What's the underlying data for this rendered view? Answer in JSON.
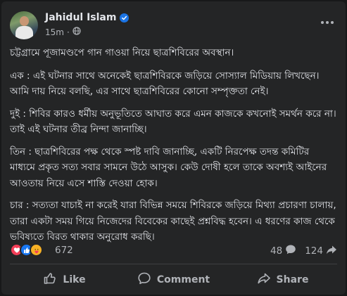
{
  "post": {
    "author": "Jahidul Islam",
    "time": "15m",
    "paragraphs": [
      "চট্টগ্রামে পূজামণ্ডপে গান গাওয়া নিয়ে ছাত্রশিবিরের অবস্থান।",
      "এক : এই ঘটনার সাথে অনেকেই ছাত্রশিবিরকে জড়িয়ে সোস্যাল মিডিয়ায় লিখছেন। আমি দায় নিয়ে বলছি, এর সাথে ছাত্রশিবিরের কোনো সম্পৃক্ততা নেই।",
      "দুই : শিবির কারও ধর্মীয় অনুভূতিতে আঘাত করে এমন কাজকে কখনোই সমর্থন করে না। তাই এই ঘটনার তীব্র নিন্দা জানাচ্ছি।",
      "তিন : ছাত্রশিবিরের পক্ষ থেকে স্পষ্ট দাবি জানাচ্ছি, একটি নিরপেক্ষ তদন্ত কমিটির মাধ্যমে প্রকৃত সত্য সবার সামনে উঠে আসুক। কেউ দোষী হলে তাকে অবশ্যই আইনের আওতায় নিয়ে এসে শাস্তি দেওয়া হোক।",
      "চার : সত্যতা যাচাই না করেই যারা বিভিন্ন সময়ে শিবিরকে জড়িয়ে মিথ্যা প্রচারণা চালায়, তারা একটা সময় গিয়ে নিজেদের বিবেকের কাছেই প্রশ্নবিদ্ধ হবেন। এ ধরণের কাজ থেকে ভবিষ্যতে বিরত থাকার অনুরোধ করছি।"
    ]
  },
  "stats": {
    "reactions": "672",
    "comments": "48",
    "shares": "124"
  },
  "actions": {
    "like": "Like",
    "comment": "Comment",
    "share": "Share"
  },
  "icons": {
    "verified": "verified-badge-icon",
    "privacy": "globe-icon",
    "more": "more-options-icon",
    "reactions": [
      "love-reaction-icon",
      "like-reaction-icon",
      "care-reaction-icon"
    ],
    "comments": "comment-bubble-icon",
    "shares": "share-arrow-icon"
  },
  "colors": {
    "background": "#242526",
    "text": "#e4e6eb",
    "muted": "#b0b3b8",
    "verified": "#1b74e4",
    "like": "#1877f2",
    "love": "#f33e58",
    "care": "#f7b125"
  }
}
